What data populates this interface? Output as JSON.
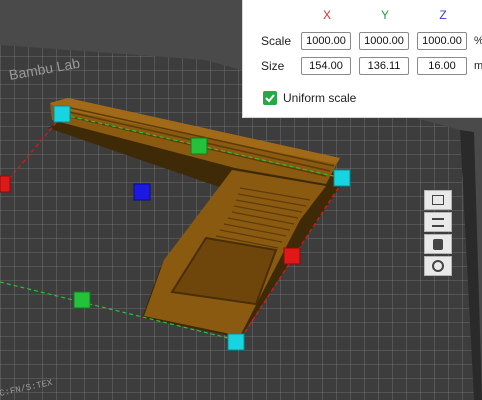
{
  "scale_panel": {
    "axes": {
      "x": "X",
      "y": "Y",
      "z": "Z"
    },
    "axis_colors": {
      "x": "#e03030",
      "y": "#2a9a3a",
      "z": "#3b3bd0"
    },
    "scale_label": "Scale",
    "size_label": "Size",
    "scale": {
      "x": "1000.00",
      "y": "1000.00",
      "z": "1000.00",
      "unit": "%"
    },
    "size": {
      "x": "154.00",
      "y": "136.11",
      "z": "16.00",
      "unit": "m"
    },
    "uniform_scale_label": "Uniform scale",
    "uniform_scale_checked": true,
    "accent_color": "#27a745"
  },
  "viewport": {
    "bed_color": "#3d3d3d",
    "model_color": "#8a5a10",
    "handle_colors": {
      "cyan": "#18d4e0",
      "green": "#23c23a",
      "red": "#e01818",
      "blue": "#1a1ae0"
    }
  },
  "side_toolbar": {
    "icons": [
      "layers-icon",
      "object-list-icon",
      "paint-icon",
      "settings-icon"
    ]
  }
}
